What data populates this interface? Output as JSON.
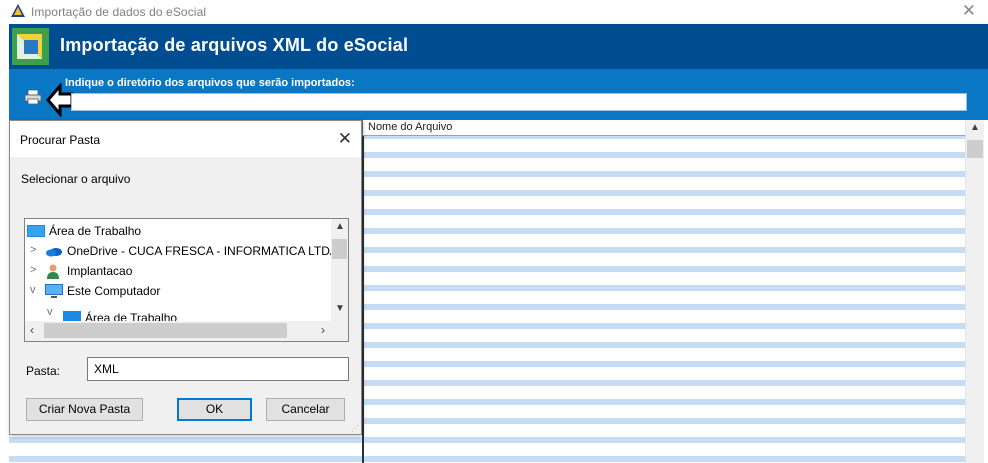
{
  "window": {
    "title": "Importação de dados do eSocial",
    "close_glyph": "✕"
  },
  "header": {
    "title": "Importação de arquivos XML do eSocial"
  },
  "directory": {
    "label": "Indique o diretório dos arquivos que serão importados:",
    "value": "",
    "icons": {
      "printer": "printer-icon",
      "arrow": "arrow-left-icon"
    }
  },
  "grid": {
    "columns": [
      "Nome do Arquivo"
    ]
  },
  "dialog": {
    "title": "Procurar Pasta",
    "close_glyph": "✕",
    "instruction": "Selecionar o arquivo",
    "tree": [
      {
        "label": "Área de Trabalho",
        "icon": "desktop-icon",
        "expander": ""
      },
      {
        "label": "OneDrive - CUCA FRESCA - INFORMATICA LTDA",
        "icon": "onedrive-cloud-icon",
        "expander": ">"
      },
      {
        "label": "Implantacao",
        "icon": "user-folder-icon",
        "expander": ">"
      },
      {
        "label": "Este Computador",
        "icon": "computer-icon",
        "expander": "v"
      },
      {
        "label": "Área de Trabalho",
        "icon": "desktop-icon",
        "expander": "v"
      }
    ],
    "folder_label": "Pasta:",
    "folder_value": "XML",
    "buttons": {
      "new_folder": "Criar Nova Pasta",
      "ok": "OK",
      "cancel": "Cancelar"
    }
  },
  "colors": {
    "header_bg": "#004d92",
    "band_bg": "#0a77c5",
    "row_stripe": "#c6dcf4",
    "accent": "#0078d7"
  }
}
